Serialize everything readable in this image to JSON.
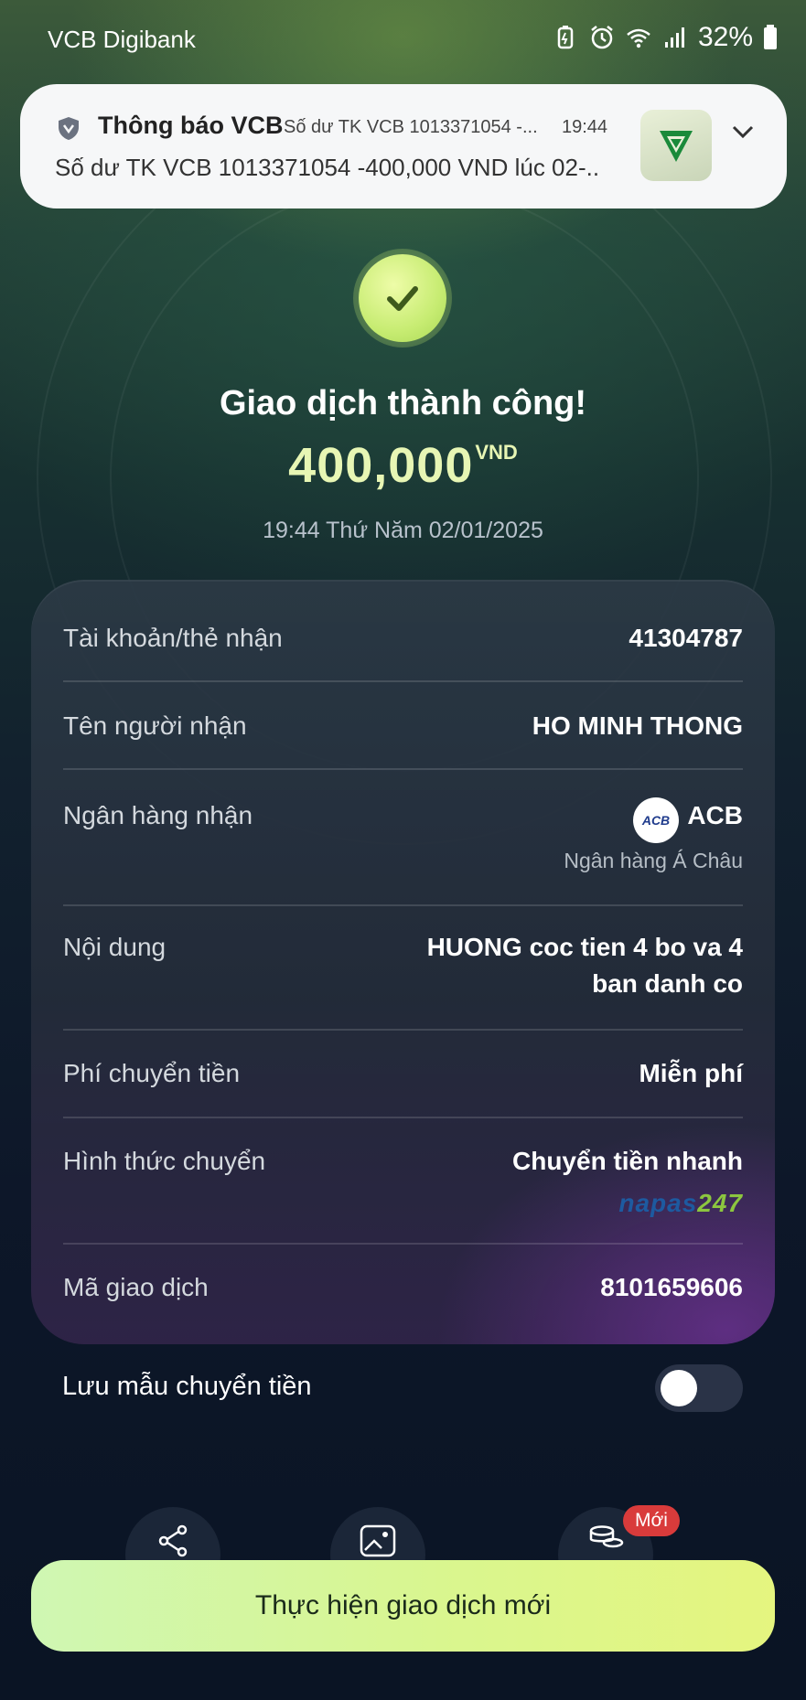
{
  "status_bar": {
    "app_name": "VCB Digibank",
    "battery": "32%",
    "icons": [
      "battery-saver-icon",
      "alarm-icon",
      "wifi-icon",
      "signal-icon",
      "battery-icon"
    ]
  },
  "notification": {
    "app": "Thông báo VCB",
    "subtitle": "Số dư TK VCB 1013371054 -...",
    "time": "19:44",
    "body": "Số dư TK VCB 1013371054 -400,000 VND lúc 02-..",
    "icons": [
      "shield-icon",
      "vcb-logo-icon",
      "chevron-down-icon"
    ]
  },
  "result": {
    "title": "Giao dịch thành công!",
    "amount": "400,000",
    "currency": "VND",
    "datetime": "19:44 Thứ Năm 02/01/2025"
  },
  "details": {
    "account_label": "Tài khoản/thẻ nhận",
    "account_value": "41304787",
    "recipient_label": "Tên người nhận",
    "recipient_value": "HO MINH THONG",
    "bank_label": "Ngân hàng nhận",
    "bank_logo_text": "ACB",
    "bank_value": "ACB",
    "bank_full": "Ngân hàng Á Châu",
    "content_label": "Nội dung",
    "content_line1": "HUONG coc tien 4 bo va 4",
    "content_line2": "ban danh co",
    "fee_label": "Phí chuyển tiền",
    "fee_value": "Miễn phí",
    "method_label": "Hình thức chuyển",
    "method_value": "Chuyển tiền nhanh",
    "napas_part1": "napas",
    "napas_part2": "247",
    "txn_label": "Mã giao dịch",
    "txn_value": "8101659606"
  },
  "save_template": {
    "label": "Lưu mẫu chuyển tiền",
    "enabled": false
  },
  "actions": {
    "new_badge": "Mới",
    "icons": [
      "share-icon",
      "save-image-icon",
      "coins-icon"
    ]
  },
  "primary_button": "Thực hiện giao dịch mới",
  "colors": {
    "accent": "#d9f68f",
    "amount": "#e7f6b4",
    "badge": "#d93b3b"
  }
}
